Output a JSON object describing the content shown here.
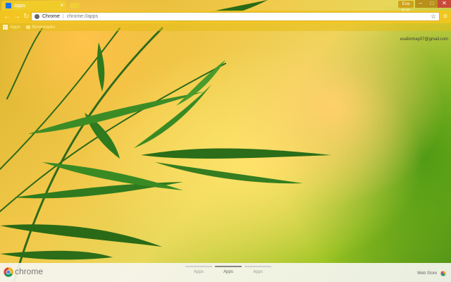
{
  "browser": {
    "tab": {
      "title": "Apps",
      "close_symbol": "×"
    },
    "user_badge": "Eva Mulh",
    "window_controls": {
      "minimize": "–",
      "maximize": "□",
      "close": "✕"
    }
  },
  "toolbar": {
    "back_symbol": "←",
    "forward_symbol": "→",
    "reload_symbol": "↻",
    "omnibox": {
      "site_label": "Chrome",
      "separator": "|",
      "url": "chrome://apps"
    },
    "star_symbol": "☆",
    "menu_symbol": "≡"
  },
  "bookmarks_bar": {
    "apps_label": "Apps",
    "bookmarks_label": "Bookmarks"
  },
  "account": {
    "email": "evaformay07@gmail.com"
  },
  "bottom_bar": {
    "brand": "chrome",
    "page_tabs": [
      {
        "label": "Apps",
        "active": false
      },
      {
        "label": "Apps",
        "active": true
      },
      {
        "label": "Apps",
        "active": false
      }
    ],
    "webstore_label": "Web Store"
  },
  "colors": {
    "toolbar": "#f3c61e",
    "tab": "#f0cd28",
    "close": "#c94a3a",
    "bottom_bar": "#f5f5f0"
  },
  "icons": [
    "back-icon",
    "forward-icon",
    "reload-icon",
    "star-icon",
    "menu-icon",
    "apps-grid-icon",
    "folder-icon",
    "chrome-logo-icon",
    "webstore-icon"
  ]
}
